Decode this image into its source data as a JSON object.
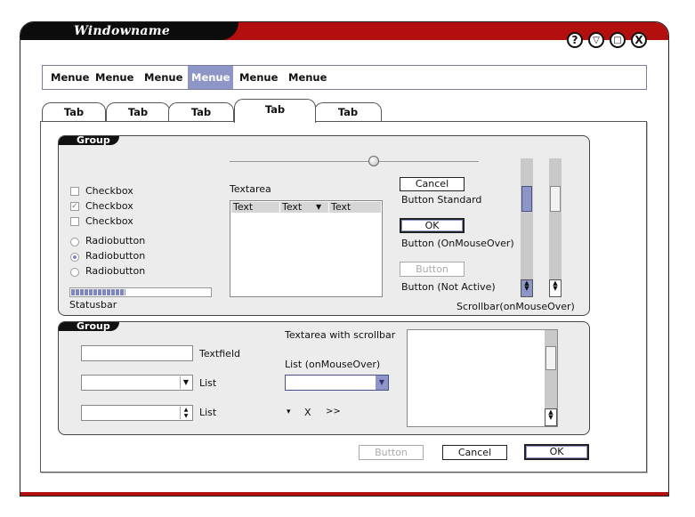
{
  "window": {
    "title": "Windowname",
    "buttons": [
      "?",
      "▽",
      "□",
      "X"
    ]
  },
  "menubar": {
    "items": [
      "Menue",
      "Menue",
      "Menue",
      "Menue",
      "Menue",
      "Menue"
    ],
    "active_index": 3
  },
  "tabs": {
    "labels": [
      "Tab",
      "Tab",
      "Tab",
      "Tab",
      "Tab"
    ],
    "active_index": 3
  },
  "group1": {
    "label": "Group",
    "checkboxes": [
      {
        "label": "Checkbox",
        "checked": false
      },
      {
        "label": "Checkbox",
        "checked": true
      },
      {
        "label": "Checkbox",
        "checked": false
      }
    ],
    "radios": [
      {
        "label": "Radiobutton",
        "selected": false
      },
      {
        "label": "Radiobutton",
        "selected": true
      },
      {
        "label": "Radiobutton",
        "selected": false
      }
    ],
    "statusbar_label": "Statusbar",
    "statusbar_progress": 0.39,
    "slider_value": 0.58,
    "textarea_label": "Textarea",
    "textarea_columns": [
      "Text",
      "Text",
      "Text"
    ],
    "buttons": {
      "cancel": "Cancel",
      "cancel_caption": "Button Standard",
      "ok": "OK",
      "ok_caption": "Button (OnMouseOver)",
      "disabled": "Button",
      "disabled_caption": "Button (Not Active)"
    },
    "scrollbar_caption": "Scrollbar(onMouseOver)"
  },
  "group2": {
    "label": "Group",
    "textfield_label": "Textfield",
    "list_label_1": "List",
    "list_label_2": "List",
    "textarea_scroll_label": "Textarea with scrollbar",
    "list_hover_label": "List (onMouseOver)",
    "mini_controls": [
      "▾",
      "X",
      ">>"
    ]
  },
  "footer": {
    "button": "Button",
    "cancel": "Cancel",
    "ok": "OK"
  },
  "colors": {
    "titlebar_red": "#b30f0f",
    "accent": "#8e95c7",
    "group_bg": "#ececec"
  }
}
